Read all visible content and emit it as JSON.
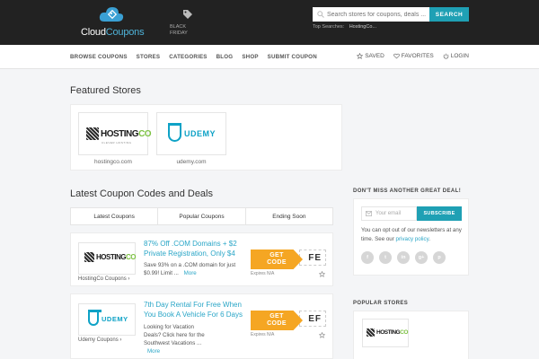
{
  "header": {
    "brand_part1": "Cloud",
    "brand_part2": "Coupons",
    "black_friday": "BLACK FRIDAY",
    "search_placeholder": "Search stores for coupons, deals ...",
    "search_button": "SEARCH",
    "top_searches_label": "Top Searches:",
    "top_searches_link": "HostingCo..."
  },
  "nav": {
    "items": [
      "BROWSE COUPONS",
      "STORES",
      "CATEGORIES",
      "BLOG",
      "SHOP",
      "SUBMIT COUPON"
    ],
    "saved": "SAVED",
    "favorites": "FAVORITES",
    "login": "LOGIN"
  },
  "featured": {
    "heading": "Featured Stores",
    "stores": [
      {
        "name": "hostingco.com",
        "logo_main": "HOSTING",
        "logo_accent": "CO",
        "logo_sub": "CLEVER HOSTING"
      },
      {
        "name": "udemy.com",
        "logo_main": "UDEMY"
      }
    ]
  },
  "latest": {
    "heading": "Latest Coupon Codes and Deals",
    "tabs": [
      "Latest Coupons",
      "Popular Coupons",
      "Ending Soon"
    ],
    "coupons": [
      {
        "store_link": "HostingCo Coupons ›",
        "title": "87% Off .COM Domains + $2 Private Registration, Only $4",
        "desc": "Save 93% on a .COM domain for just $0.99! Limit",
        "more": "More",
        "code_peek": "FE",
        "code_label_1": "GET",
        "code_label_2": "CODE",
        "expires": "Expires N/A"
      },
      {
        "store_link": "Udemy Coupons ›",
        "title": "7th Day Rental For Free When You Book A Vehicle For 6 Days",
        "desc": "Looking for Vacation Deals? Click here for the Southwest Vacations ...",
        "more": "More",
        "code_peek": "EF",
        "code_label_1": "GET",
        "code_label_2": "CODE",
        "expires": "Expires N/A"
      }
    ]
  },
  "sidebar": {
    "newsletter_title": "DON'T MISS ANOTHER GREAT DEAL!",
    "email_placeholder": "Your email",
    "subscribe": "SUBSCRIBE",
    "optout_text": "You can opt out of our newsletters at any time. See our",
    "privacy_link": "privacy policy",
    "optout_end": ".",
    "socials": [
      "f",
      "t",
      "in",
      "g+",
      "p"
    ],
    "popular_title": "POPULAR STORES"
  },
  "colors": {
    "accent": "#1fa0b4",
    "link": "#2aa6c7",
    "code_button": "#f5a623",
    "header_bg": "#222222"
  }
}
